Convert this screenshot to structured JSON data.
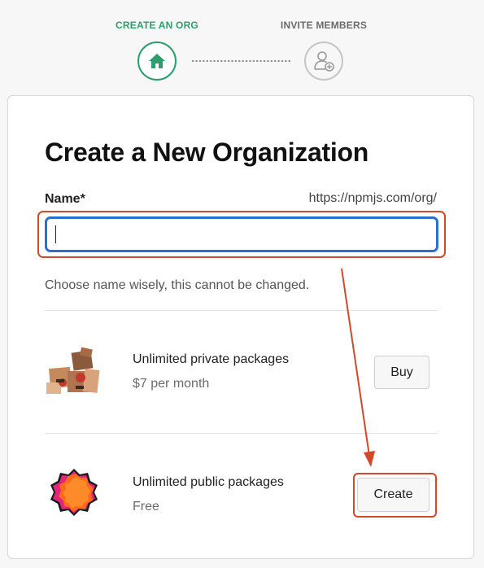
{
  "stepper": {
    "step1_label": "CREATE AN ORG",
    "step2_label": "INVITE MEMBERS",
    "step1_icon": "home-icon",
    "step2_icon": "add-user-icon",
    "active_color": "#2e9e6e"
  },
  "form": {
    "title": "Create a New Organization",
    "name_label": "Name*",
    "url_prefix": "https://npmjs.com/org/",
    "name_value": "",
    "hint": "Choose name wisely, this cannot be changed."
  },
  "plans": [
    {
      "title": "Unlimited private packages",
      "price": "$7 per month",
      "button_label": "Buy",
      "icon": "boxes-illustration-icon"
    },
    {
      "title": "Unlimited public packages",
      "price": "Free",
      "button_label": "Create",
      "icon": "orange-badge-icon"
    }
  ],
  "annotation_color": "#d0492a"
}
